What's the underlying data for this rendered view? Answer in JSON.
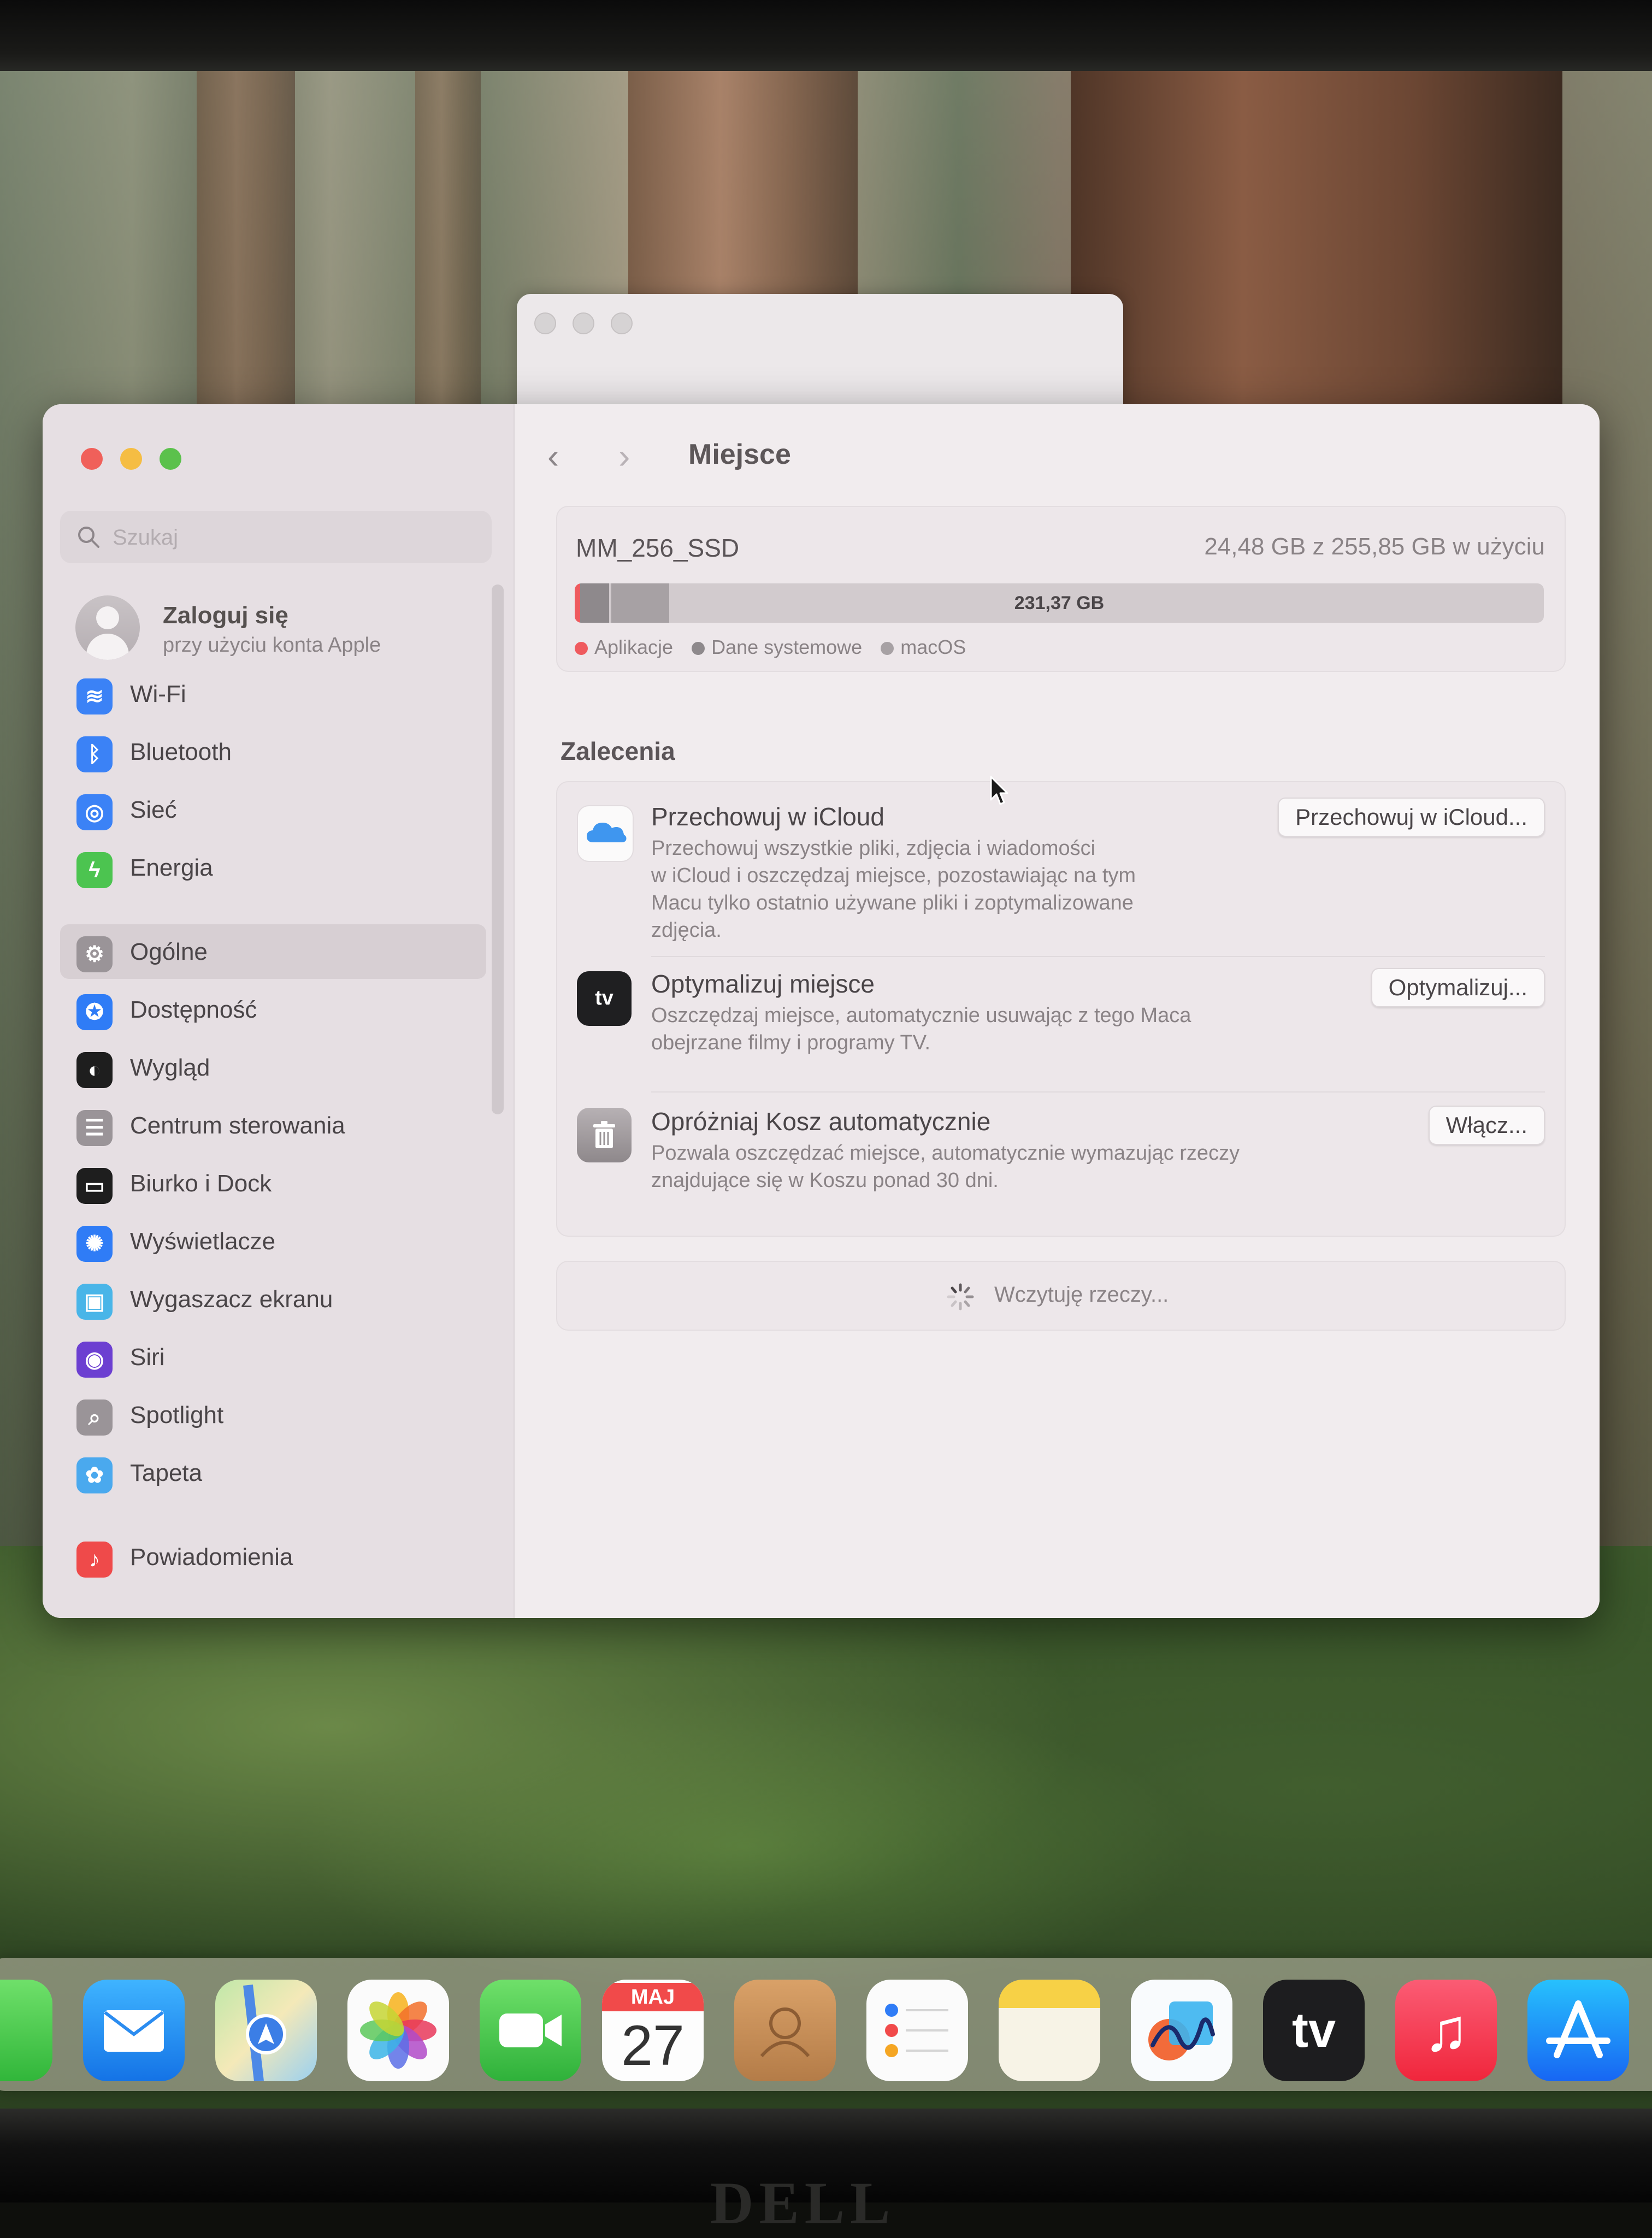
{
  "sidebar": {
    "search_placeholder": "Szukaj",
    "account": {
      "title": "Zaloguj się",
      "subtitle": "przy użyciu konta Apple"
    },
    "items": [
      {
        "label": "Wi-Fi",
        "icon": "wifi-icon",
        "color": "#3b82f6"
      },
      {
        "label": "Bluetooth",
        "icon": "bluetooth-icon",
        "color": "#3b82f6"
      },
      {
        "label": "Sieć",
        "icon": "globe-icon",
        "color": "#3b82f6"
      },
      {
        "label": "Energia",
        "icon": "bolt-icon",
        "color": "#4cc450"
      },
      {
        "label": "Ogólne",
        "icon": "gear-icon",
        "color": "#9a9498",
        "selected": true
      },
      {
        "label": "Dostępność",
        "icon": "accessibility-icon",
        "color": "#2f7cf6"
      },
      {
        "label": "Wygląd",
        "icon": "appearance-icon",
        "color": "#1e1e1e"
      },
      {
        "label": "Centrum sterowania",
        "icon": "control-center-icon",
        "color": "#9a9498"
      },
      {
        "label": "Biurko i Dock",
        "icon": "dock-icon",
        "color": "#1e1e1e"
      },
      {
        "label": "Wyświetlacze",
        "icon": "sun-icon",
        "color": "#2f7cf6"
      },
      {
        "label": "Wygaszacz ekranu",
        "icon": "screensaver-icon",
        "color": "#49b5e8"
      },
      {
        "label": "Siri",
        "icon": "siri-icon",
        "color": "#6c3fd1"
      },
      {
        "label": "Spotlight",
        "icon": "magnifier-icon",
        "color": "#9a9498"
      },
      {
        "label": "Tapeta",
        "icon": "flower-icon",
        "color": "#4aa9ee"
      },
      {
        "label": "Powiadomienia",
        "icon": "bell-icon",
        "color": "#ef4a4a"
      }
    ]
  },
  "content": {
    "title": "Miejsce",
    "storage": {
      "disk_name": "MM_256_SSD",
      "usage_text": "24,48 GB z 255,85 GB w użyciu",
      "free_label": "231,37 GB",
      "segments": [
        {
          "label": "Aplikacje",
          "color": "#ef5a5e",
          "fraction": 0.004
        },
        {
          "label": "Dane systemowe",
          "color": "#8e898c",
          "fraction": 0.03
        },
        {
          "label": "macOS",
          "color": "#a7a1a4",
          "fraction": 0.06
        }
      ]
    },
    "recommendations_title": "Zalecenia",
    "recommendations": [
      {
        "title": "Przechowuj w iCloud",
        "desc": [
          "Przechowuj wszystkie pliki, zdjęcia i wiadomości",
          "w iCloud i oszczędzaj miejsce, pozostawiając na tym",
          "Macu tylko ostatnio używane pliki i zoptymalizowane",
          "zdjęcia."
        ],
        "button": "Przechowuj w iCloud...",
        "icon": "icloud-icon"
      },
      {
        "title": "Optymalizuj miejsce",
        "desc": [
          "Oszczędzaj miejsce, automatycznie usuwając z tego Maca",
          "obejrzane filmy i programy TV."
        ],
        "button": "Optymalizuj...",
        "icon": "appletv-icon",
        "icon_text": "tv"
      },
      {
        "title": "Opróżniaj Kosz automatycznie",
        "desc": [
          "Pozwala oszczędzać miejsce, automatycznie wymazując rzeczy",
          "znajdujące się w Koszu ponad 30 dni."
        ],
        "button": "Włącz...",
        "icon": "trash-icon"
      }
    ],
    "loading_text": "Wczytuję rzeczy..."
  },
  "dock": {
    "calendar_month": "MAJ",
    "calendar_day": "27",
    "tv_label": "tv",
    "apps": [
      "messages-icon",
      "mail-icon",
      "maps-icon",
      "photos-icon",
      "facetime-icon",
      "calendar-icon",
      "contacts-icon",
      "reminders-icon",
      "notes-icon",
      "freeform-icon",
      "tv-app-icon",
      "music-icon",
      "app-store-icon"
    ]
  },
  "bezel": {
    "brand": "DELL"
  }
}
